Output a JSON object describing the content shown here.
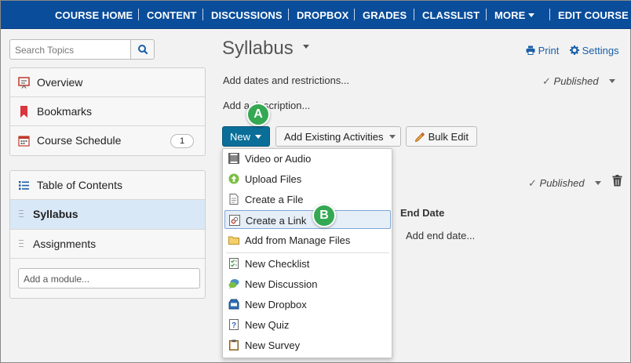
{
  "topnav": {
    "items": [
      "COURSE HOME",
      "CONTENT",
      "DISCUSSIONS",
      "DROPBOX",
      "GRADES",
      "CLASSLIST",
      "MORE",
      "EDIT COURSE"
    ]
  },
  "sidebar": {
    "search_placeholder": "Search Topics",
    "top_items": [
      {
        "label": "Overview",
        "icon": "overview-icon"
      },
      {
        "label": "Bookmarks",
        "icon": "bookmark-icon"
      },
      {
        "label": "Course Schedule",
        "icon": "calendar-icon",
        "badge": "1"
      }
    ],
    "toc_label": "Table of Contents",
    "modules": [
      {
        "label": "Syllabus",
        "selected": true
      },
      {
        "label": "Assignments",
        "selected": false
      }
    ],
    "add_module_placeholder": "Add a module..."
  },
  "main": {
    "title": "Syllabus",
    "print_label": "Print",
    "settings_label": "Settings",
    "add_dates": "Add dates and restrictions...",
    "add_description": "Add a description...",
    "published_label": "Published",
    "toolbar": {
      "new_label": "New",
      "add_existing_label": "Add Existing Activities",
      "bulk_edit_label": "Bulk Edit"
    },
    "item_published_label": "Published",
    "end_date_header": "End Date",
    "add_end_date": "Add end date..."
  },
  "new_menu": {
    "group1": [
      {
        "label": "Video or Audio",
        "icon": "video-icon"
      },
      {
        "label": "Upload Files",
        "icon": "upload-icon"
      },
      {
        "label": "Create a File",
        "icon": "file-icon"
      },
      {
        "label": "Create a Link",
        "icon": "link-icon",
        "highlighted": true
      },
      {
        "label": "Add from Manage Files",
        "icon": "folder-icon"
      }
    ],
    "group2": [
      {
        "label": "New Checklist",
        "icon": "checklist-icon"
      },
      {
        "label": "New Discussion",
        "icon": "discussion-icon"
      },
      {
        "label": "New Dropbox",
        "icon": "dropbox-icon"
      },
      {
        "label": "New Quiz",
        "icon": "quiz-icon"
      },
      {
        "label": "New Survey",
        "icon": "survey-icon"
      }
    ]
  },
  "callouts": {
    "a": "A",
    "b": "B"
  },
  "colors": {
    "nav": "#0a4d9b",
    "accent": "#0a6e99",
    "callout": "#35a853",
    "selected_row": "#d9e8f7"
  }
}
